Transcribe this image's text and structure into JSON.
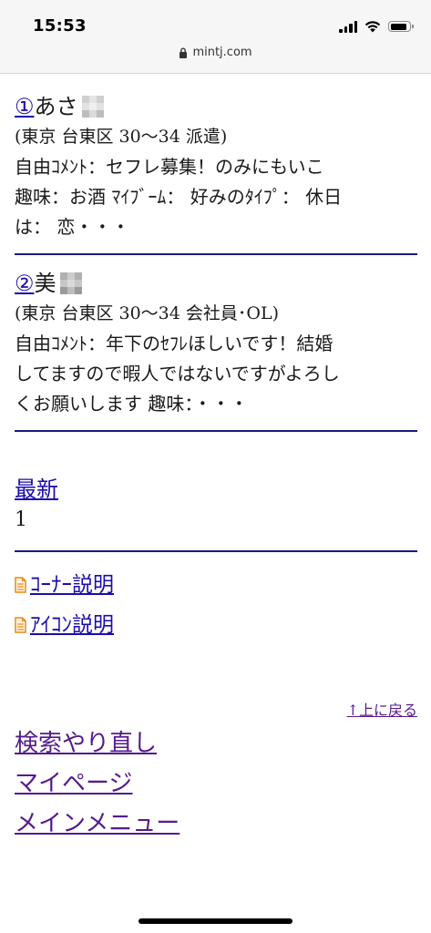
{
  "status": {
    "time": "15:53"
  },
  "browser": {
    "url": "mintj.com"
  },
  "entries": [
    {
      "number": "①",
      "name": "あさ",
      "location": "(東京 台東区 30〜34 派遣)",
      "lines": [
        "自由ｺﾒﾝﾄ：セフレ募集！のみにもいこ",
        "趣味：お酒 ﾏｲﾌﾞｰﾑ： 好みのﾀｲﾌﾟ： 休日",
        "は： 恋・・・"
      ]
    },
    {
      "number": "②",
      "name": "美",
      "location": "(東京 台東区 30〜34 会社員･OL)",
      "lines": [
        "自由ｺﾒﾝﾄ：年下のｾﾌﾚほしいです！結婚",
        "してますので暇人ではないですがよろし",
        "くお願いします 趣味：・・・"
      ]
    }
  ],
  "pagination": {
    "latest_label": "最新",
    "page": "1"
  },
  "help_links": {
    "corner": "ｺｰﾅｰ説明",
    "icon": "ｱｲｺﾝ説明"
  },
  "back_to_top": "↑上に戻る",
  "nav": {
    "research": "検索やり直し",
    "mypage": "マイページ",
    "main_menu": "メインメニュー"
  }
}
